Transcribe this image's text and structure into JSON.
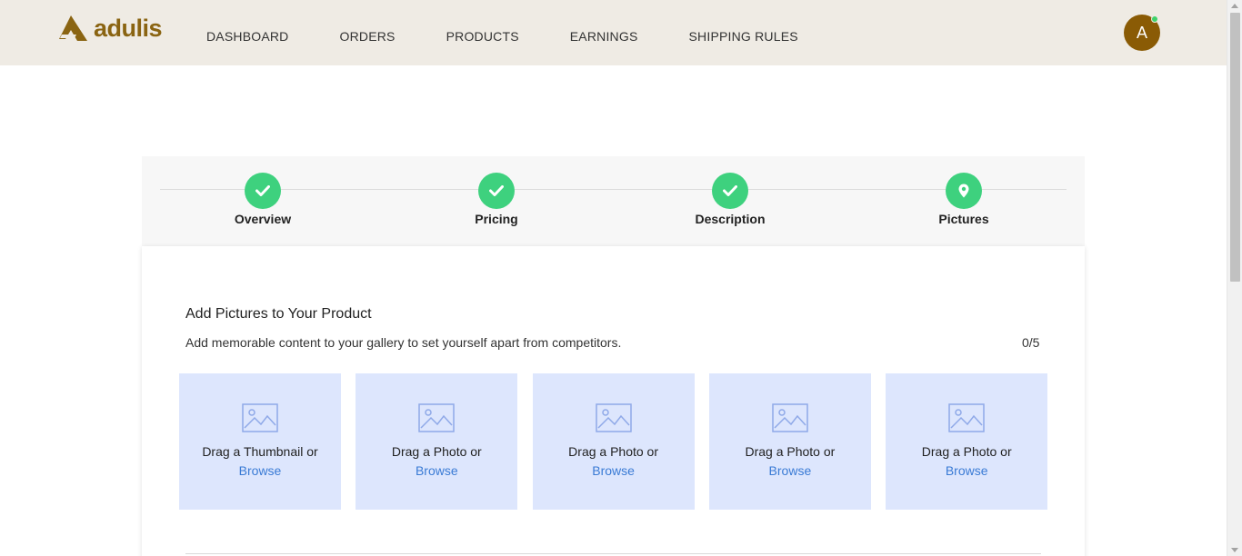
{
  "header": {
    "logo_text": "adulis",
    "nav": [
      "DASHBOARD",
      "ORDERS",
      "PRODUCTS",
      "EARNINGS",
      "SHIPPING RULES"
    ],
    "avatar_initial": "A",
    "status_color": "#3fd26b"
  },
  "stepper": {
    "steps": [
      {
        "label": "Overview",
        "icon": "check-icon",
        "state": "complete"
      },
      {
        "label": "Pricing",
        "icon": "check-icon",
        "state": "complete"
      },
      {
        "label": "Description",
        "icon": "check-icon",
        "state": "complete"
      },
      {
        "label": "Pictures",
        "icon": "map-pin-icon",
        "state": "current"
      }
    ],
    "accent_color": "#3ed17e"
  },
  "pictures": {
    "title": "Add Pictures to Your Product",
    "subtitle": "Add memorable content to your gallery to set yourself apart from competitors.",
    "count": "0/5",
    "tiles": [
      {
        "text": "Drag a Thumbnail or",
        "browse": "Browse",
        "icon": "image-placeholder-icon"
      },
      {
        "text": "Drag a Photo or",
        "browse": "Browse",
        "icon": "image-placeholder-icon"
      },
      {
        "text": "Drag a Photo or",
        "browse": "Browse",
        "icon": "image-placeholder-icon"
      },
      {
        "text": "Drag a Photo or",
        "browse": "Browse",
        "icon": "image-placeholder-icon"
      },
      {
        "text": "Drag a Photo or",
        "browse": "Browse",
        "icon": "image-placeholder-icon"
      }
    ],
    "tile_color": "#dde6fd",
    "link_color": "#3a7bd5"
  }
}
